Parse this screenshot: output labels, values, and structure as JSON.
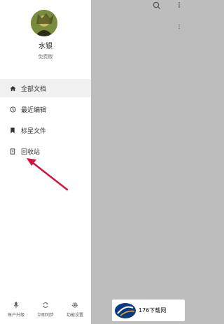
{
  "profile": {
    "username": "水银",
    "plan": "免费版"
  },
  "nav": {
    "items": [
      {
        "label": "全部文档",
        "icon": "home-icon"
      },
      {
        "label": "最近编辑",
        "icon": "clock-icon"
      },
      {
        "label": "标星文件",
        "icon": "bookmark-icon"
      },
      {
        "label": "回收站",
        "icon": "trash-icon"
      }
    ]
  },
  "bottom": {
    "items": [
      {
        "label": "账户升级",
        "icon": "microphone-icon"
      },
      {
        "label": "立即同步",
        "icon": "sync-icon"
      },
      {
        "label": "功能设置",
        "icon": "gear-icon"
      }
    ]
  },
  "watermark": {
    "text": "176下载网"
  },
  "colors": {
    "drawer_bg": "#ffffff",
    "overlay_bg": "#bdbdbd",
    "active_item_bg": "#f0f0f0",
    "arrow": "#d0143c"
  }
}
